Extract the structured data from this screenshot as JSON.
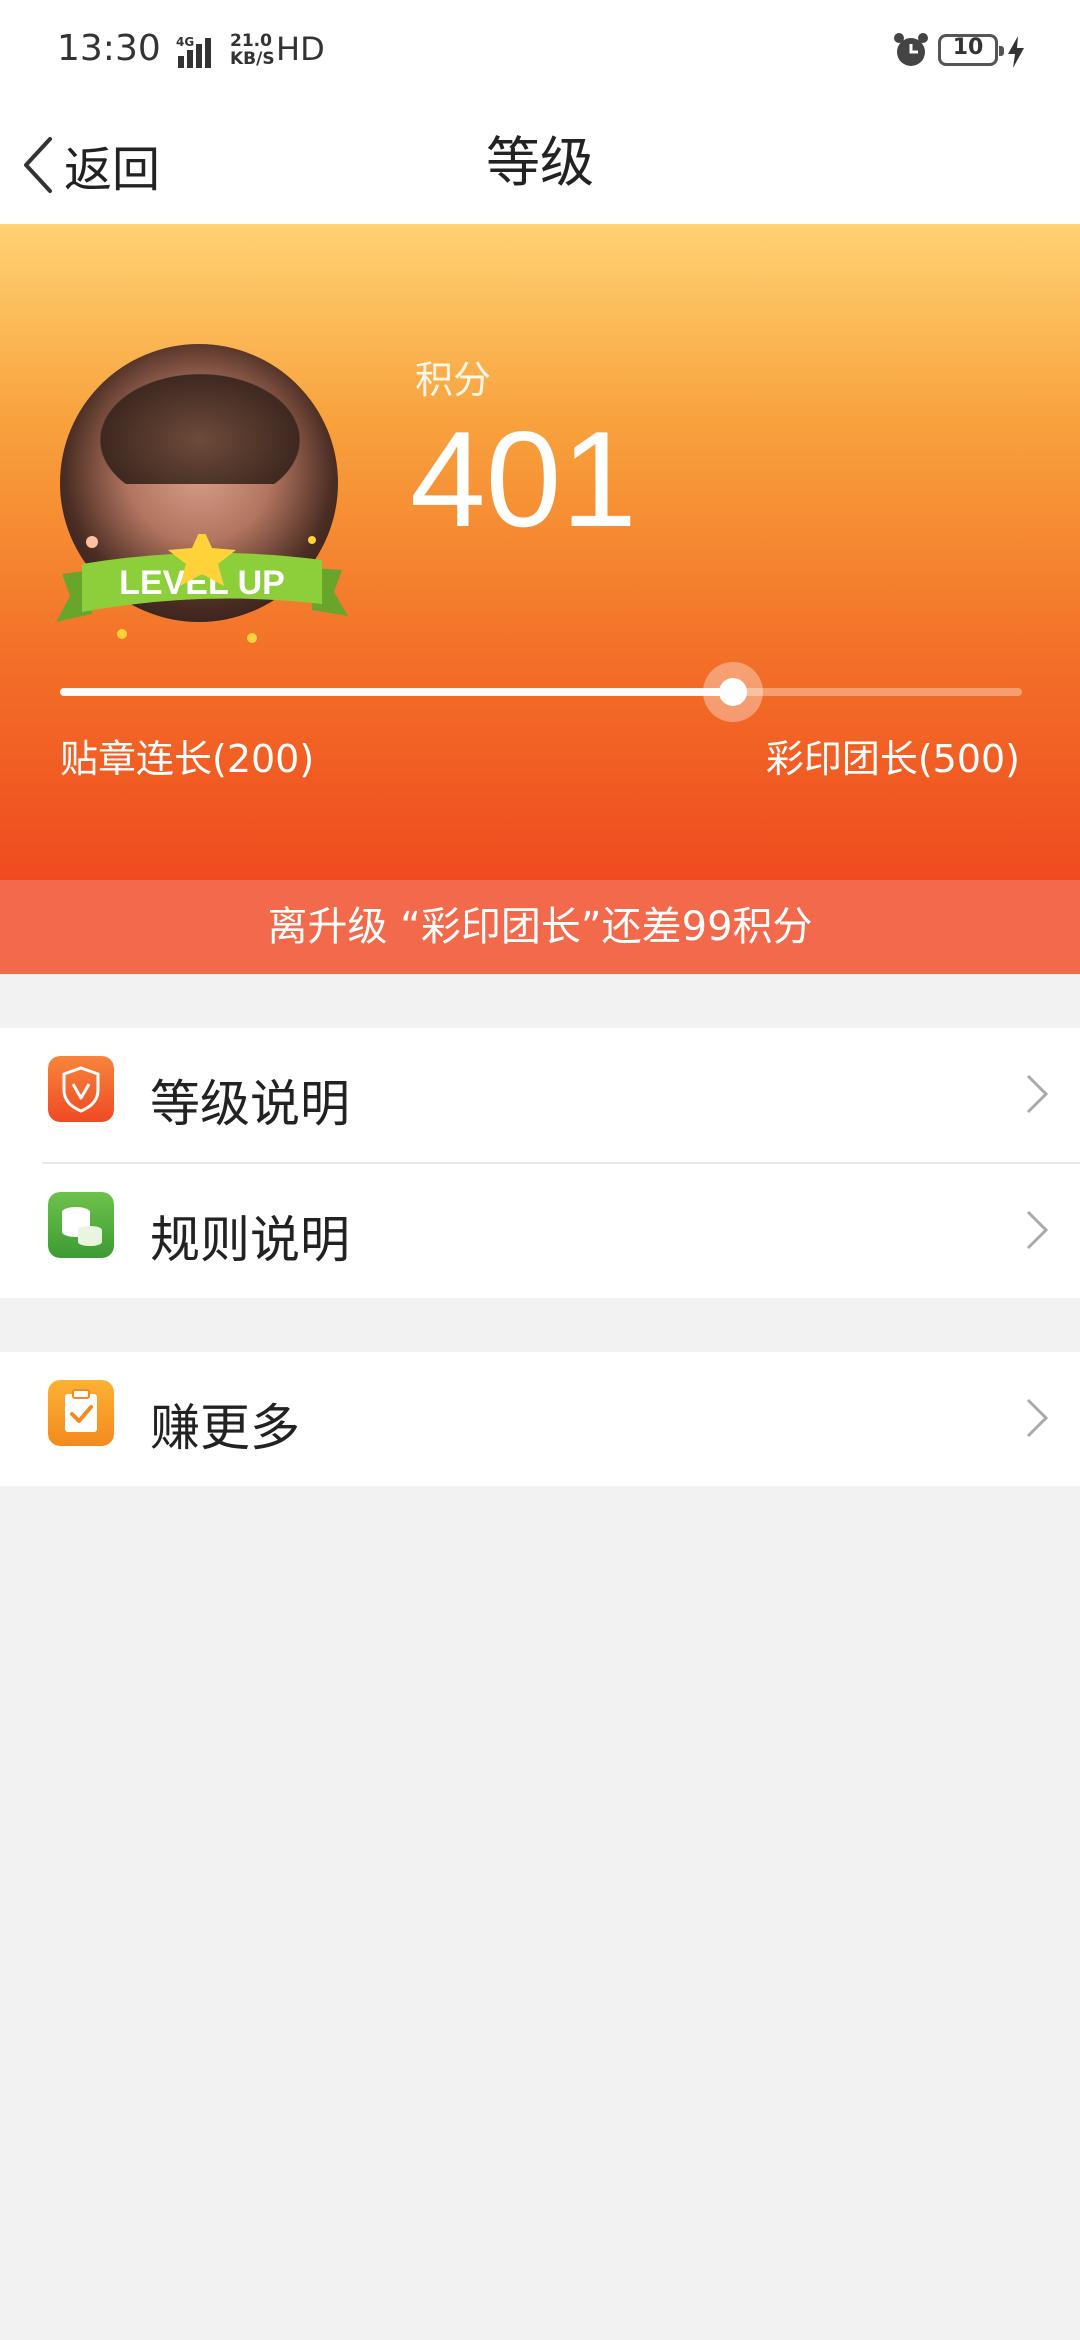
{
  "status_bar": {
    "time": "13:30",
    "network": "4G",
    "speed_top": "21.0",
    "speed_bottom": "KB/S",
    "hd": "HD",
    "battery": "10"
  },
  "nav": {
    "back_label": "返回",
    "title": "等级"
  },
  "hero": {
    "points_label": "积分",
    "points_value": "401",
    "badge_text": "LEVEL UP",
    "progress": 0.7,
    "current_level": "贴章连长(200)",
    "next_level": "彩印团长(500)"
  },
  "banner": {
    "text": "离升级 “彩印团长”还差99积分"
  },
  "menu": {
    "items": [
      {
        "label": "等级说明",
        "icon": "shield-v-icon",
        "color": "#f05a2b"
      },
      {
        "label": "规则说明",
        "icon": "coins-icon",
        "color": "#4db043"
      }
    ],
    "earn": {
      "label": "赚更多",
      "icon": "clipboard-check-icon",
      "color": "#f79a26"
    }
  }
}
